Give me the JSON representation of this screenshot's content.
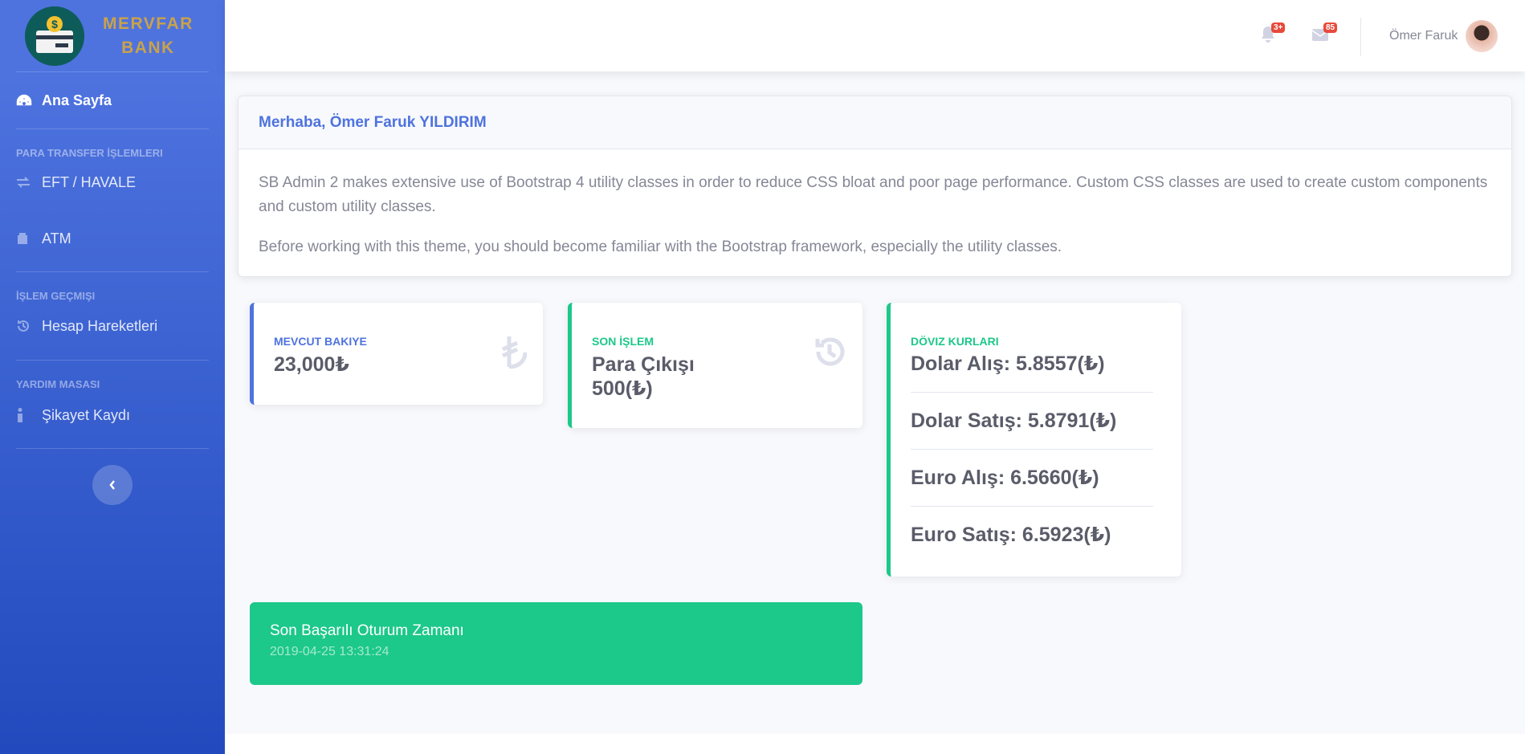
{
  "brand": {
    "line1": "MERVFAR",
    "line2": "BANK"
  },
  "sidebar": {
    "home": "Ana Sayfa",
    "heading_transfer": "PARA TRANSFER İŞLEMLERI",
    "eft": "EFT / HAVALE",
    "atm": "ATM",
    "heading_history": "İŞLEM GEÇMIŞI",
    "history": "Hesap Hareketleri",
    "heading_help": "YARDIM MASASI",
    "complaint": "Şikayet Kaydı"
  },
  "topbar": {
    "alerts_badge": "3+",
    "messages_badge": "85",
    "user_name": "Ömer Faruk"
  },
  "welcome": {
    "title": "Merhaba, Ömer Faruk YILDIRIM",
    "p1": "SB Admin 2 makes extensive use of Bootstrap 4 utility classes in order to reduce CSS bloat and poor page performance. Custom CSS classes are used to create custom components and custom utility classes.",
    "p2": "Before working with this theme, you should become familiar with the Bootstrap framework, especially the utility classes."
  },
  "balance": {
    "label": "MEVCUT BAKIYE",
    "value": "23,000₺"
  },
  "last_tx": {
    "label": "SON İŞLEM",
    "line1": "Para Çıkışı",
    "line2": "500(₺)"
  },
  "rates": {
    "label": "DÖVIZ KURLARI",
    "items": [
      "Dolar Alış: 5.8557(₺)",
      "Dolar Satış: 5.8791(₺)",
      "Euro Alış: 6.5660(₺)",
      "Euro Satış: 6.5923(₺)"
    ]
  },
  "session": {
    "title": "Son Başarılı Oturum Zamanı",
    "time": "2019-04-25 13:31:24"
  },
  "colors": {
    "primary": "#4e73df",
    "success": "#1cc88a",
    "danger": "#e74a3b"
  }
}
